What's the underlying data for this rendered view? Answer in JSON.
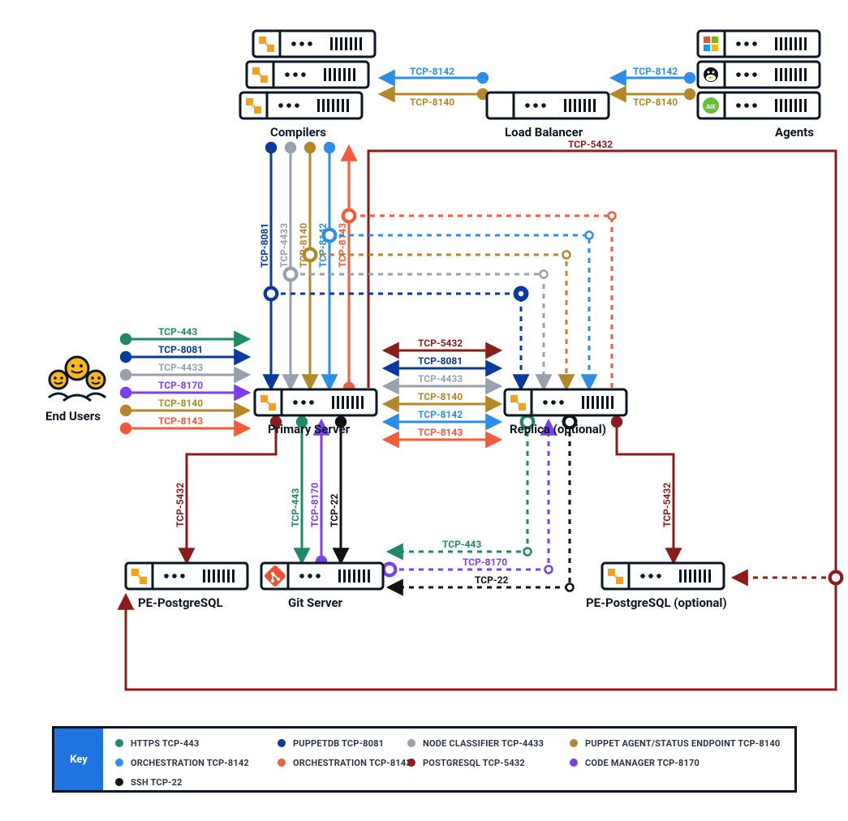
{
  "nodes": {
    "compilers": "Compilers",
    "load_balancer": "Load Balancer",
    "agents": "Agents",
    "end_users": "End Users",
    "primary_server": "Primary Server",
    "replica": "Replica (optional)",
    "git_server": "Git Server",
    "pe_pg_left": "PE-PostgreSQL",
    "pe_pg_right": "PE-PostgreSQL (optional)"
  },
  "ports": {
    "tcp443": "TCP-443",
    "tcp8081": "TCP-8081",
    "tcp4433": "TCP-4433",
    "tcp8170": "TCP-8170",
    "tcp8140": "TCP-8140",
    "tcp8143": "TCP-8143",
    "tcp8142": "TCP-8142",
    "tcp5432": "TCP-5432",
    "tcp22": "TCP-22"
  },
  "colors": {
    "https": "#1d8a6a",
    "puppetdb": "#0b3a9e",
    "nodeclass": "#98a1ad",
    "agent": "#b4872a",
    "orch8142": "#2e8ee6",
    "orch8143": "#f25c3b",
    "postgres": "#8b1c1c",
    "codemgr": "#7b3ff2",
    "ssh": "#111111"
  },
  "key": {
    "title": "Key",
    "items": [
      {
        "color": "https",
        "label": "HTTPS TCP-443"
      },
      {
        "color": "puppetdb",
        "label": "PUPPETDB TCP-8081"
      },
      {
        "color": "nodeclass",
        "label": "NODE CLASSIFIER TCP-4433"
      },
      {
        "color": "agent",
        "label": "PUPPET AGENT/STATUS ENDPOINT TCP-8140"
      },
      {
        "color": "orch8142",
        "label": "ORCHESTRATION TCP-8142"
      },
      {
        "color": "orch8143",
        "label": "ORCHESTRATION TCP-8143"
      },
      {
        "color": "postgres",
        "label": "POSTGRESQL TCP-5432"
      },
      {
        "color": "codemgr",
        "label": "CODE MANAGER TCP-8170"
      },
      {
        "color": "ssh",
        "label": "SSH TCP-22"
      }
    ]
  },
  "chart_data": {
    "type": "network-diagram",
    "components": [
      {
        "id": "compilers",
        "label": "Compilers",
        "stack": 3
      },
      {
        "id": "lb",
        "label": "Load Balancer"
      },
      {
        "id": "agents",
        "label": "Agents",
        "stack": 3,
        "os_icons": [
          "windows",
          "linux",
          "aix"
        ]
      },
      {
        "id": "primary",
        "label": "Primary Server"
      },
      {
        "id": "replica",
        "label": "Replica (optional)"
      },
      {
        "id": "git",
        "label": "Git Server"
      },
      {
        "id": "pg_left",
        "label": "PE-PostgreSQL"
      },
      {
        "id": "pg_right",
        "label": "PE-PostgreSQL (optional)"
      },
      {
        "id": "end_users",
        "label": "End Users"
      }
    ],
    "edges": [
      {
        "from": "agents",
        "to": "lb",
        "port": "TCP-8142",
        "color": "orch8142"
      },
      {
        "from": "agents",
        "to": "lb",
        "port": "TCP-8140",
        "color": "agent"
      },
      {
        "from": "lb",
        "to": "compilers",
        "port": "TCP-8142",
        "color": "orch8142"
      },
      {
        "from": "lb",
        "to": "compilers",
        "port": "TCP-8140",
        "color": "agent"
      },
      {
        "from": "compilers",
        "to": "primary",
        "port": "TCP-8081",
        "color": "puppetdb"
      },
      {
        "from": "compilers",
        "to": "primary",
        "port": "TCP-4433",
        "color": "nodeclass"
      },
      {
        "from": "compilers",
        "to": "primary",
        "port": "TCP-8140",
        "color": "agent"
      },
      {
        "from": "compilers",
        "to": "primary",
        "port": "TCP-8142",
        "color": "orch8142"
      },
      {
        "from": "primary",
        "to": "compilers",
        "port": "TCP-8143",
        "color": "orch8143"
      },
      {
        "from": "compilers",
        "to": "primary",
        "port": "TCP-5432",
        "color": "postgres",
        "route": "right-loop"
      },
      {
        "from": "end_users",
        "to": "primary",
        "port": "TCP-443",
        "color": "https"
      },
      {
        "from": "end_users",
        "to": "primary",
        "port": "TCP-8081",
        "color": "puppetdb"
      },
      {
        "from": "end_users",
        "to": "primary",
        "port": "TCP-4433",
        "color": "nodeclass"
      },
      {
        "from": "end_users",
        "to": "primary",
        "port": "TCP-8170",
        "color": "codemgr"
      },
      {
        "from": "end_users",
        "to": "primary",
        "port": "TCP-8140",
        "color": "agent"
      },
      {
        "from": "end_users",
        "to": "primary",
        "port": "TCP-8143",
        "color": "orch8143"
      },
      {
        "from": "primary",
        "to": "replica",
        "port": "TCP-5432",
        "color": "postgres",
        "bidir": true
      },
      {
        "from": "primary",
        "to": "replica",
        "port": "TCP-8081",
        "color": "puppetdb",
        "bidir": true
      },
      {
        "from": "primary",
        "to": "replica",
        "port": "TCP-4433",
        "color": "nodeclass",
        "bidir": true
      },
      {
        "from": "primary",
        "to": "replica",
        "port": "TCP-8140",
        "color": "agent",
        "bidir": true
      },
      {
        "from": "primary",
        "to": "replica",
        "port": "TCP-8142",
        "color": "orch8142",
        "bidir": true
      },
      {
        "from": "primary",
        "to": "replica",
        "port": "TCP-8143",
        "color": "orch8143",
        "bidir": true
      },
      {
        "from": "compilers",
        "to": "replica",
        "port": "TCP-8081",
        "color": "puppetdb",
        "dashed": true
      },
      {
        "from": "compilers",
        "to": "replica",
        "port": "TCP-4433",
        "color": "nodeclass",
        "dashed": true
      },
      {
        "from": "compilers",
        "to": "replica",
        "port": "TCP-8140",
        "color": "agent",
        "dashed": true
      },
      {
        "from": "compilers",
        "to": "replica",
        "port": "TCP-8142",
        "color": "orch8142",
        "dashed": true
      },
      {
        "from": "replica",
        "to": "compilers",
        "port": "TCP-8143",
        "color": "orch8143",
        "dashed": true
      },
      {
        "from": "primary",
        "to": "git",
        "port": "TCP-443",
        "color": "https"
      },
      {
        "from": "git",
        "to": "primary",
        "port": "TCP-8170",
        "color": "codemgr"
      },
      {
        "from": "primary",
        "to": "git",
        "port": "TCP-22",
        "color": "ssh"
      },
      {
        "from": "replica",
        "to": "git",
        "port": "TCP-443",
        "color": "https",
        "dashed": true
      },
      {
        "from": "git",
        "to": "replica",
        "port": "TCP-8170",
        "color": "codemgr",
        "dashed": true
      },
      {
        "from": "replica",
        "to": "git",
        "port": "TCP-22",
        "color": "ssh",
        "dashed": true
      },
      {
        "from": "primary",
        "to": "pg_left",
        "port": "TCP-5432",
        "color": "postgres"
      },
      {
        "from": "replica",
        "to": "pg_right",
        "port": "TCP-5432",
        "color": "postgres"
      },
      {
        "from": "pg_left",
        "to": "pg_right",
        "port": "TCP-5432",
        "color": "postgres",
        "route": "bottom-loop",
        "dashed_seg": "right-half"
      }
    ]
  }
}
